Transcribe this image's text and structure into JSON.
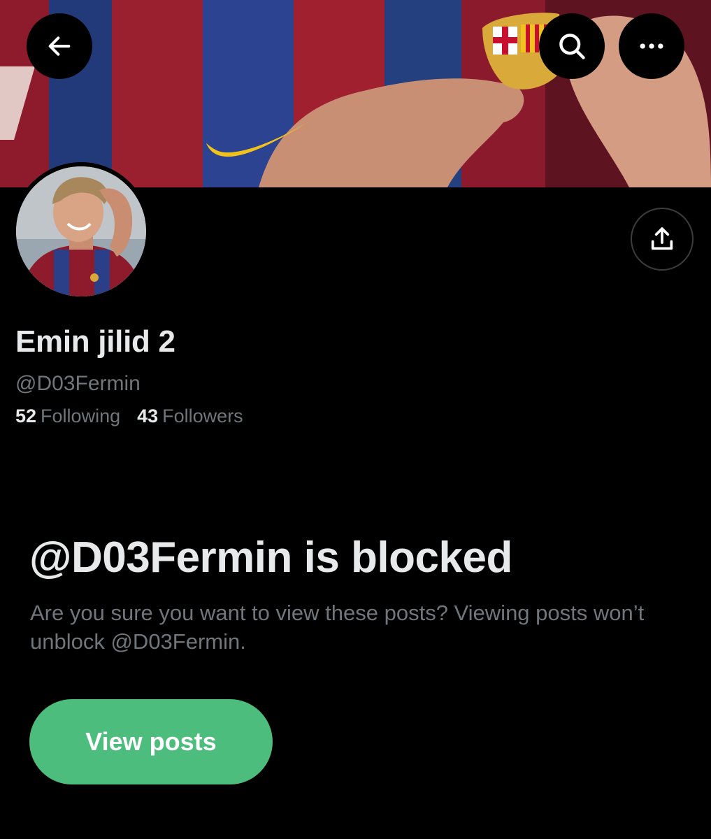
{
  "header": {
    "back_icon": "arrow-left-icon",
    "search_icon": "search-icon",
    "more_icon": "more-horizontal-icon"
  },
  "profile": {
    "display_name": "Emin jilid 2",
    "handle": "@D03Fermin",
    "following_count": "52",
    "following_label": "Following",
    "followers_count": "43",
    "followers_label": "Followers",
    "share_icon": "share-icon"
  },
  "blocked": {
    "title": "@D03Fermin is blocked",
    "description": "Are you sure you want to view these posts? Viewing posts won’t unblock @D03Fermin.",
    "button_label": "View posts"
  },
  "colors": {
    "background": "#000000",
    "primary_text": "#e7e9ea",
    "secondary_text": "#71767b",
    "button_bg": "#4dbd7d"
  }
}
